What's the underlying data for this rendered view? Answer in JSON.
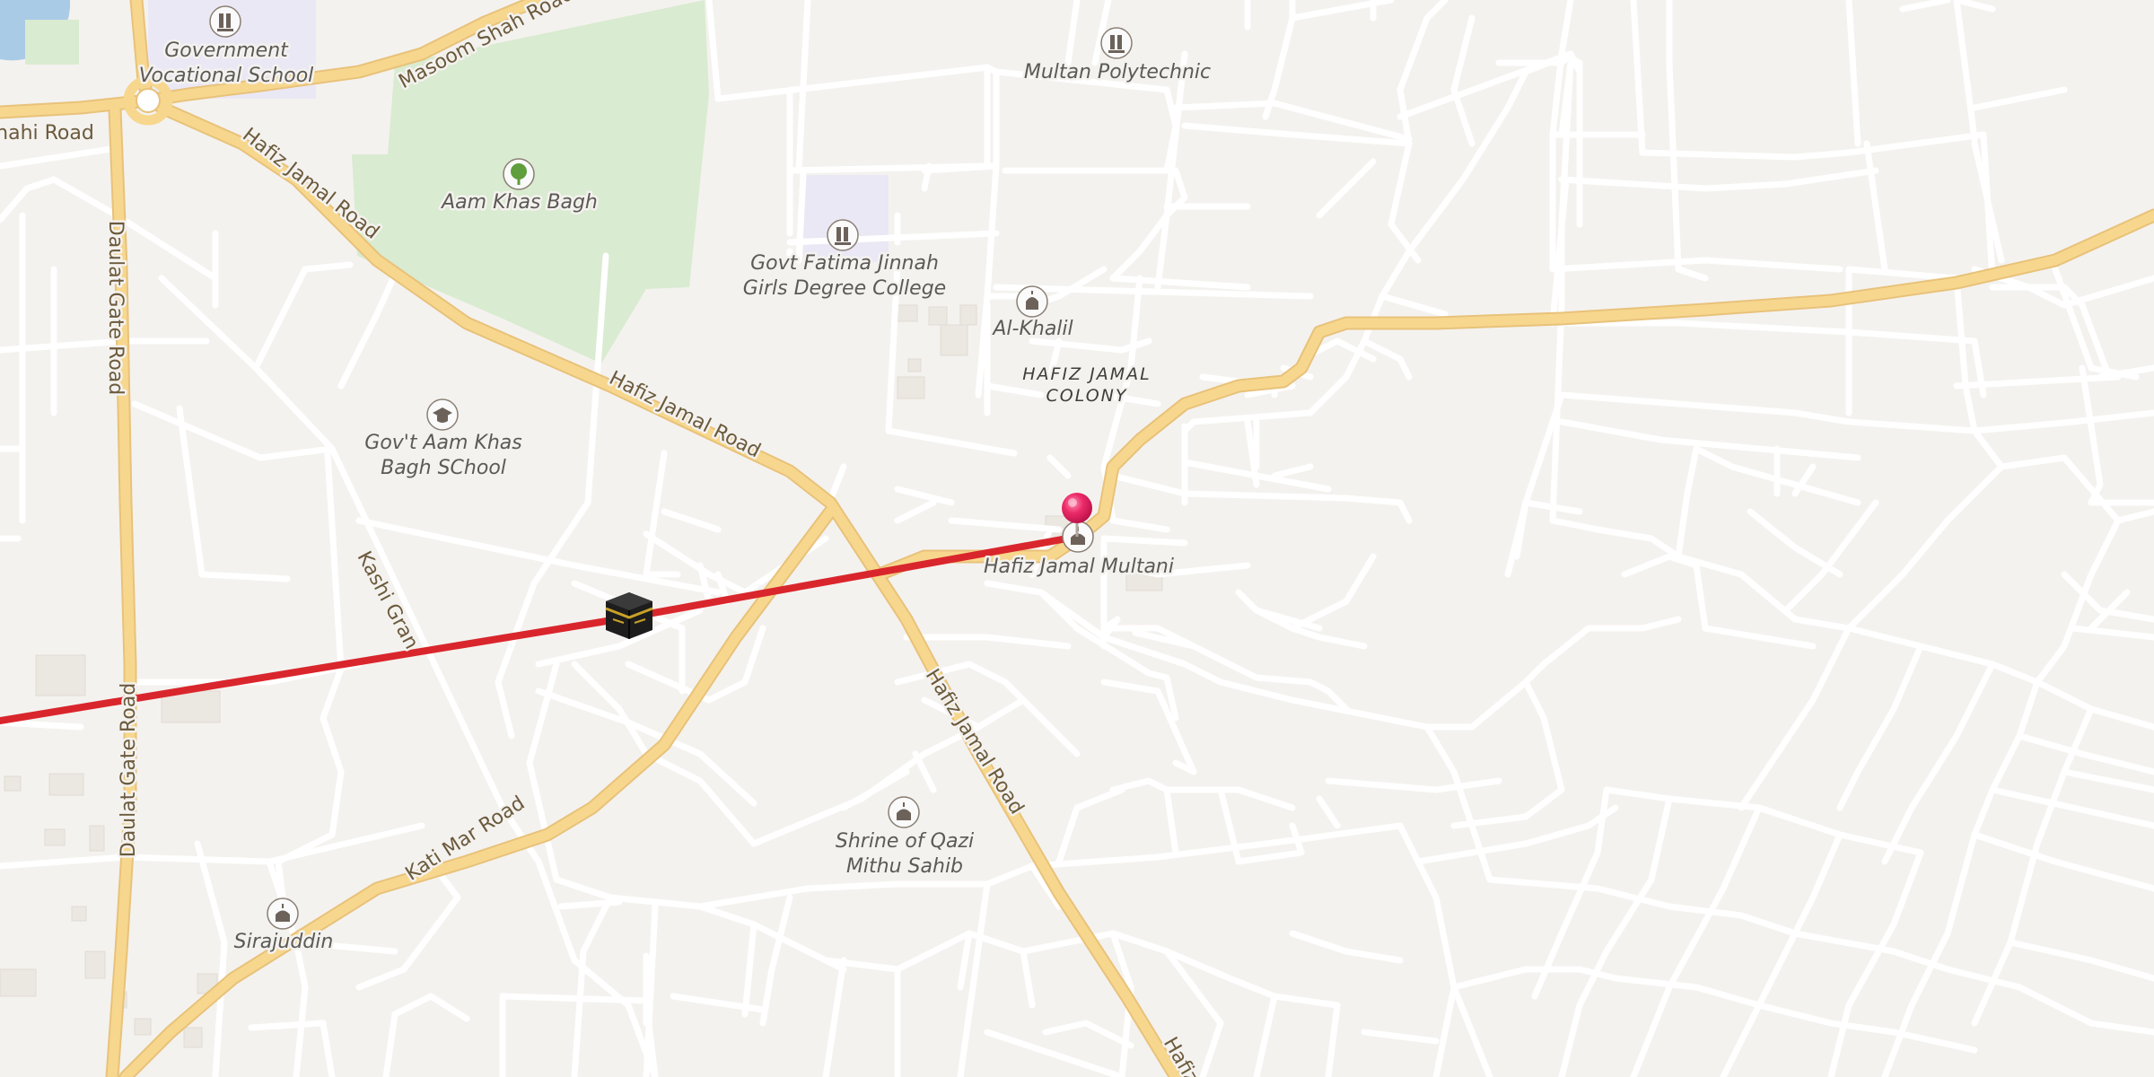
{
  "map": {
    "places": {
      "vocational_school": [
        "Government",
        "Vocational School"
      ],
      "polytechnic": "Multan Polytechnic",
      "aam_khas_bagh": "Aam Khas Bagh",
      "fatima_jinnah_college": [
        "Govt Fatima Jinnah",
        "Girls Degree College"
      ],
      "al_khalil": "Al-Khalil",
      "hafiz_jamal_colony": [
        "HAFIZ JAMAL",
        "COLONY"
      ],
      "aam_khas_school": [
        "Gov't Aam Khas",
        "Bagh SChool"
      ],
      "hafiz_jamal_multani": "Hafiz Jamal Multani",
      "qazi_shrine": [
        "Shrine of Qazi",
        "Mithu Sahib"
      ],
      "sirajuddin": "Sirajuddin"
    },
    "roads": {
      "masoom_shah": "Masoom Shah Road",
      "hafiz_jamal_1": "Hafiz Jamal Road",
      "hafiz_jamal_2": "Hafiz Jamal Road",
      "hafiz_jamal_3": "Hafiz Jamal Road",
      "hafiz_jamal_cut": "Hafiz",
      "daulat_gate_1": "Daulat Gate Road",
      "daulat_gate_2": "Daulat Gate Road",
      "kashi_gran": "Kashi Gran",
      "kati_mar": "Kati Mar Road",
      "shahi_road_cut": "hahi Road"
    },
    "icons": {
      "school": "school-icon",
      "college": "education-icon",
      "park": "tree-icon",
      "mosque": "mosque-icon",
      "shrine": "shrine-icon",
      "pin": "map-pin",
      "kaaba": "kaaba-icon"
    },
    "colors": {
      "background": "#f4f2ef",
      "street": "#ffffff",
      "main_road": "#f7d78e",
      "main_road_casing": "#e8c27a",
      "park": "#d9ebd0",
      "institution": "#ebe8f5",
      "water": "#a9cbe6",
      "route_line": "#d9262c",
      "pin": "#e8195a"
    }
  }
}
